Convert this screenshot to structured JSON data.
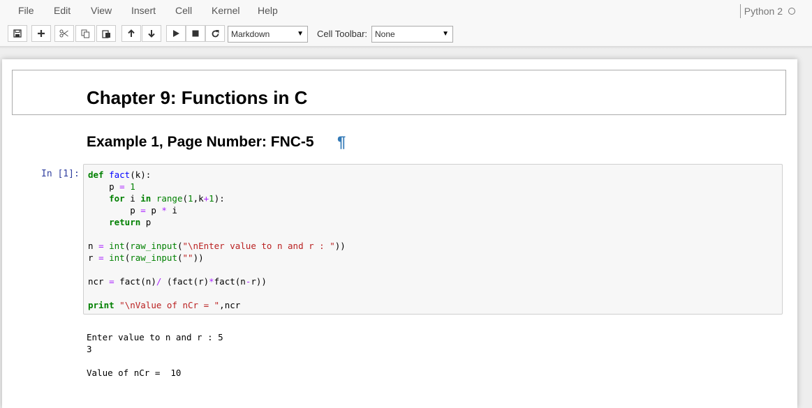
{
  "menubar": {
    "items": [
      "File",
      "Edit",
      "View",
      "Insert",
      "Cell",
      "Kernel",
      "Help"
    ],
    "kernel_name": "Python 2"
  },
  "toolbar": {
    "cell_type_value": "Markdown",
    "cell_toolbar_label": "Cell Toolbar:",
    "cell_toolbar_value": "None"
  },
  "notebook": {
    "title": "Chapter 9: Functions in C",
    "subtitle": "Example 1, Page Number: FNC-5",
    "pilcrow": "¶",
    "prompt": "In [1]:",
    "code": [
      "def fact(k):",
      "    p = 1",
      "    for i in range(1,k+1):",
      "        p = p * i",
      "    return p",
      "",
      "n = int(raw_input(\"\\nEnter value to n and r : \"))",
      "r = int(raw_input(\"\"))",
      "",
      "ncr = fact(n)/ (fact(r)*fact(n-r))",
      "",
      "print \"\\nValue of nCr = \",ncr"
    ],
    "output": [
      "Enter value to n and r : 5",
      "3",
      "",
      "Value of nCr =  10"
    ]
  },
  "icons": [
    "save-icon",
    "plus-icon",
    "cut-icon",
    "copy-icon",
    "paste-icon",
    "arrow-up-icon",
    "arrow-down-icon",
    "run-icon",
    "stop-icon",
    "restart-icon"
  ]
}
